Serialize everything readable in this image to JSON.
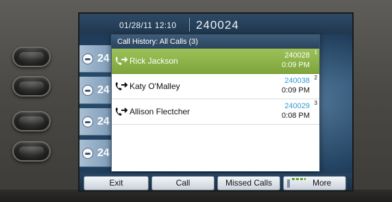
{
  "status": {
    "datetime": "01/28/11 12:10",
    "extension": "240024"
  },
  "lines": [
    {
      "label": "24"
    },
    {
      "label": "24"
    },
    {
      "label": "24"
    },
    {
      "label": "24"
    }
  ],
  "popup": {
    "title": "Call History: All Calls (3)",
    "calls": [
      {
        "name": "Rick Jackson",
        "number": "240028",
        "time": "0:09 PM",
        "index": "1",
        "selected": true
      },
      {
        "name": "Katy O'Malley",
        "number": "240038",
        "time": "0:09 PM",
        "index": "2",
        "selected": false
      },
      {
        "name": "Allison Flectcher",
        "number": "240029",
        "time": "0:08 PM",
        "index": "3",
        "selected": false
      }
    ]
  },
  "softkeys": {
    "exit": "Exit",
    "call": "Call",
    "missed": "Missed Calls",
    "more": "More"
  },
  "icons": {
    "call": "outgoing-call-icon",
    "handset": "handset-icon"
  },
  "colors": {
    "selected_row": "#8db34a",
    "number_text": "#2e9ad0",
    "screen_bg": "#284c6e"
  }
}
